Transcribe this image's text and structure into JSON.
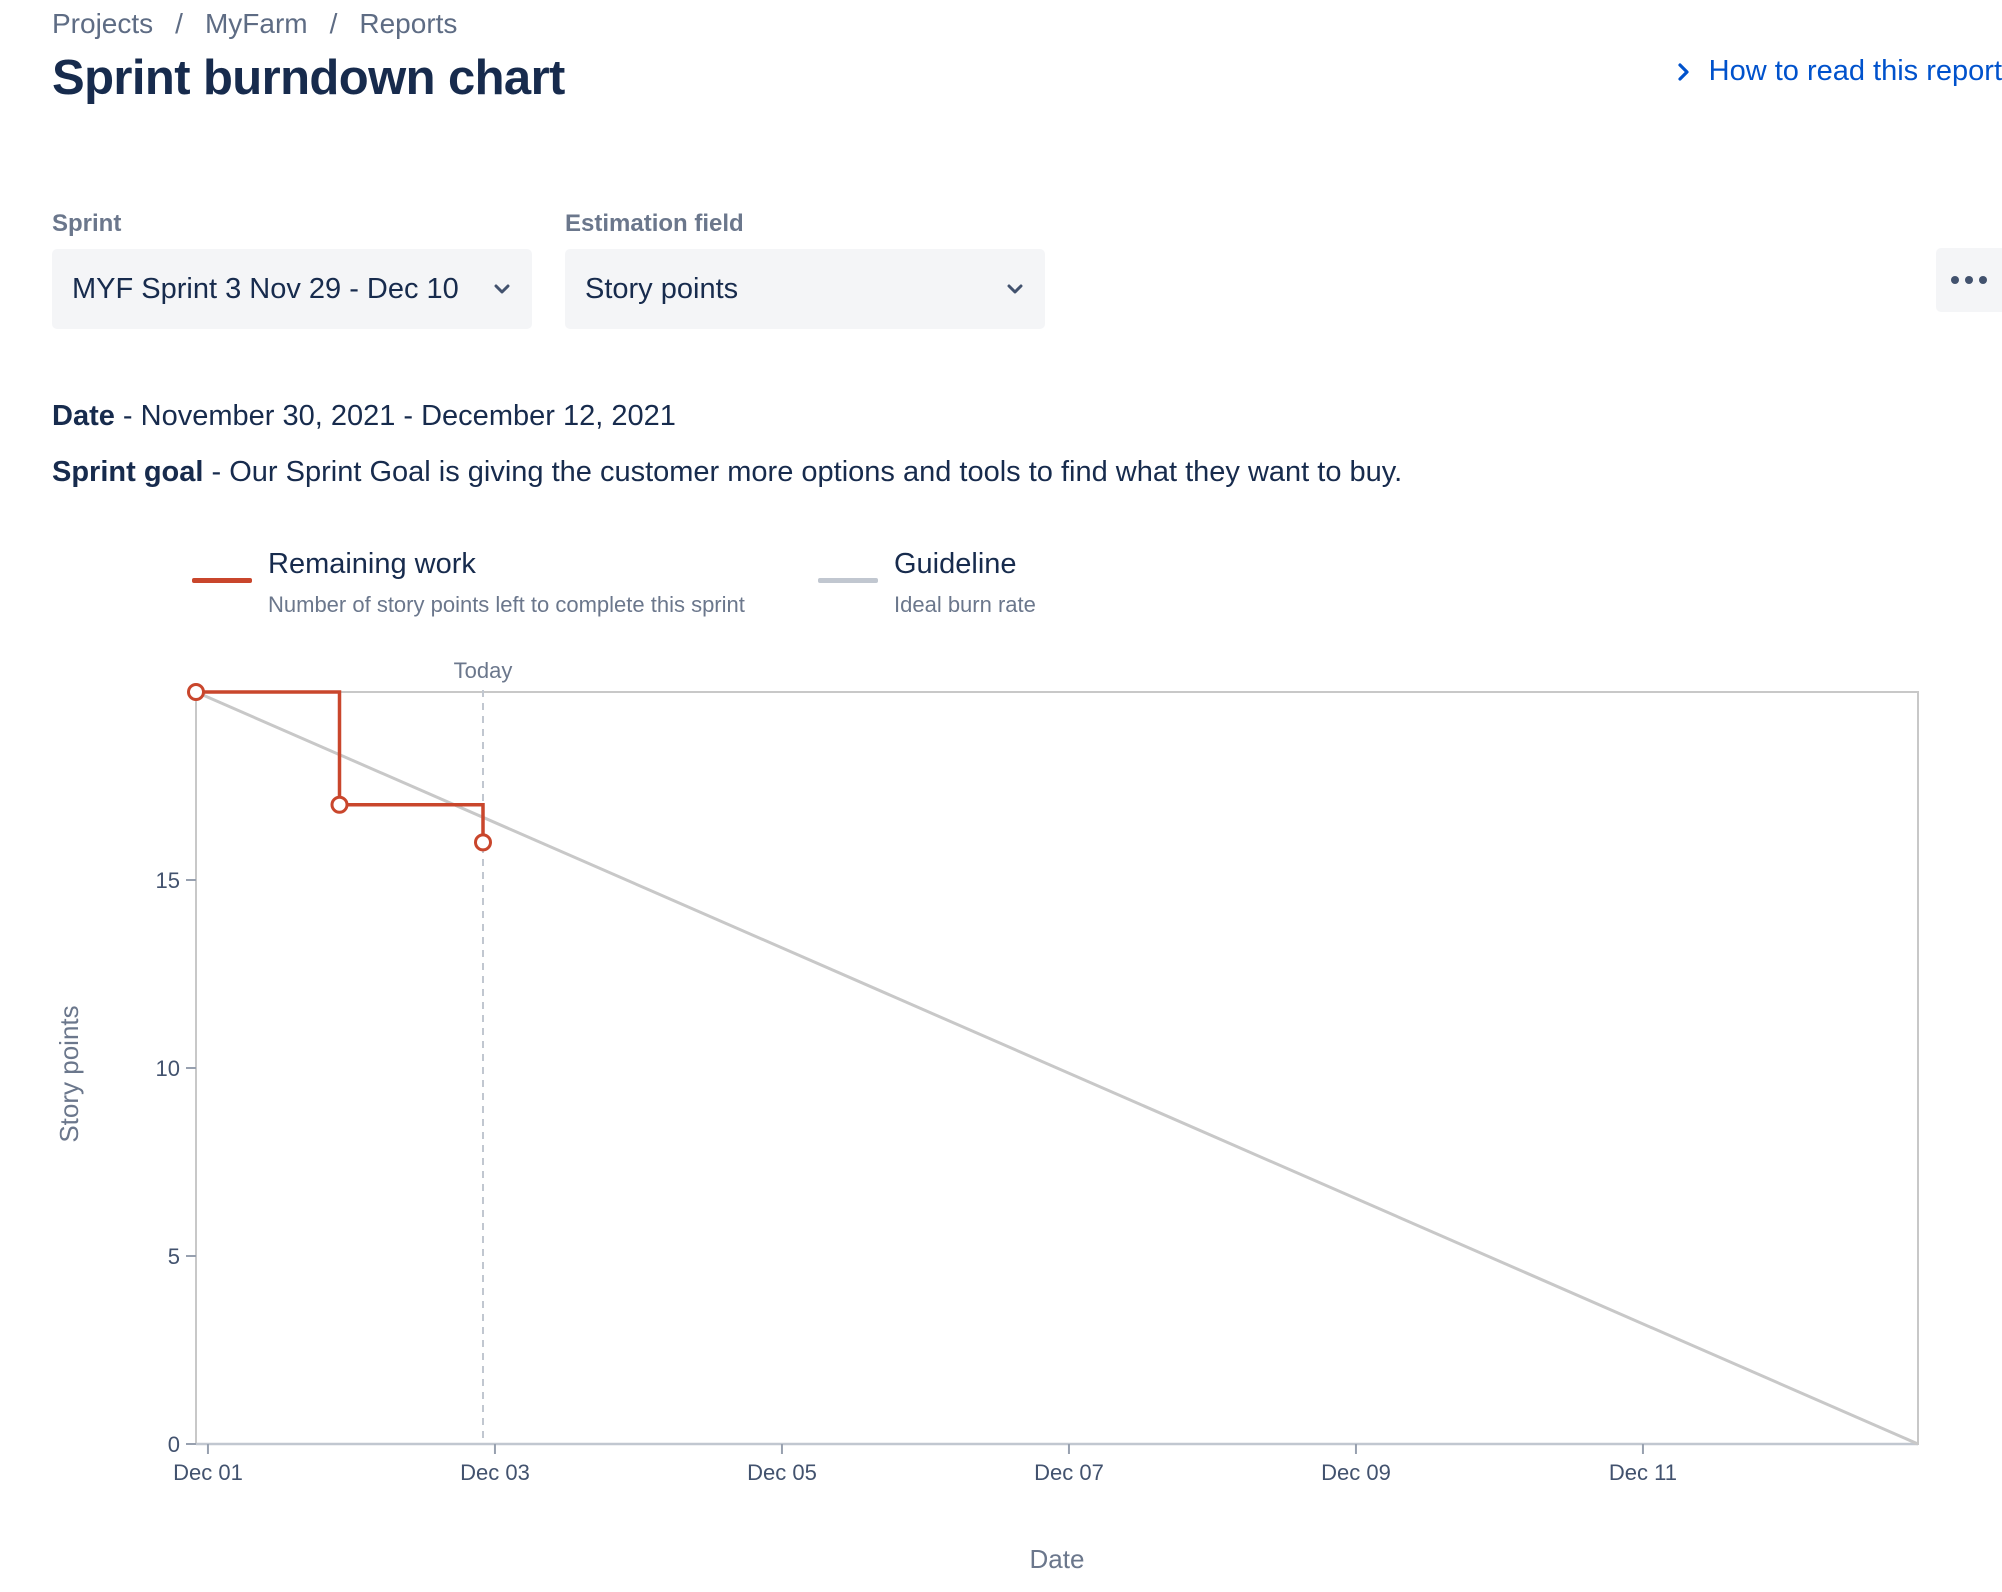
{
  "breadcrumb": [
    "Projects",
    "MyFarm",
    "Reports"
  ],
  "page_title": "Sprint burndown chart",
  "help_link": "How to read this report",
  "filters": {
    "sprint_label": "Sprint",
    "sprint_value": "MYF Sprint 3 Nov 29 - Dec 10",
    "estimation_label": "Estimation field",
    "estimation_value": "Story points"
  },
  "sprint_info": {
    "date_label": "Date",
    "date_value": " - November 30, 2021 - December 12, 2021",
    "goal_label": "Sprint goal",
    "goal_value": " - Our Sprint Goal is giving the customer more options and tools to find what they want to buy."
  },
  "legend": [
    {
      "title": "Remaining work",
      "description": "Number of story points left to complete this sprint",
      "color": "#C9462C"
    },
    {
      "title": "Guideline",
      "description": "Ideal burn rate",
      "color": "#C1C7D0"
    }
  ],
  "colors": {
    "remaining_work": "#C9462C",
    "guideline": "#C8C8C8",
    "link": "#0052CC",
    "text": "#172B4D",
    "muted": "#6B778C"
  },
  "chart_data": {
    "type": "line",
    "xlabel": "Date",
    "ylabel": "Story points",
    "ylim": [
      0,
      20
    ],
    "xlim": [
      "2021-11-30T22:00",
      "2021-12-12T22:00"
    ],
    "y_ticks": [
      0,
      5,
      10,
      15
    ],
    "x_ticks": [
      "Dec 01",
      "Dec 03",
      "Dec 05",
      "Dec 07",
      "Dec 09",
      "Dec 11"
    ],
    "x_tick_dates": [
      "2021-12-01",
      "2021-12-03",
      "2021-12-05",
      "2021-12-07",
      "2021-12-09",
      "2021-12-11"
    ],
    "today_label": "Today",
    "today": "2021-12-02T22:00",
    "series": [
      {
        "name": "Remaining work",
        "style": "step",
        "points": [
          {
            "x": "2021-11-30T22:00",
            "y": 20
          },
          {
            "x": "2021-12-01T22:00",
            "y": 17
          },
          {
            "x": "2021-12-02T22:00",
            "y": 16
          }
        ]
      },
      {
        "name": "Guideline",
        "style": "linear",
        "points": [
          {
            "x": "2021-11-30T22:00",
            "y": 20
          },
          {
            "x": "2021-12-12T22:00",
            "y": 0
          }
        ]
      }
    ],
    "grid": false,
    "legend_position": "top-left"
  }
}
